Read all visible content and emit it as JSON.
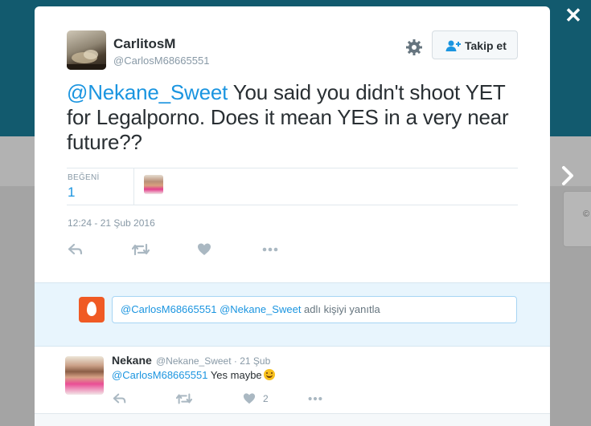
{
  "tweet": {
    "author": {
      "name": "CarlitosM",
      "handle": "@CarlosM68665551"
    },
    "follow_label": "Takip et",
    "text_mention": "@Nekane_Sweet",
    "text_rest": " You said you didn't shoot YET for Legalporno. Does it mean YES in a very near future??",
    "likes_label": "BEĞENİ",
    "likes_count": "1",
    "timestamp": "12:24 - 21 Şub 2016"
  },
  "reply_box": {
    "mention1": "@CarlosM68665551",
    "mention2": "@Nekane_Sweet",
    "suffix": " adlı kişiyi yanıtla"
  },
  "reply": {
    "name": "Nekane",
    "meta": "@Nekane_Sweet · 21 Şub",
    "mention": "@CarlosM68665551",
    "text": " Yes maybe",
    "like_count": "2"
  },
  "icons": [
    "close-icon",
    "chevron-right-icon",
    "gear-icon",
    "follow-user-icon",
    "reply-icon",
    "retweet-icon",
    "heart-icon",
    "more-icon",
    "egg-icon",
    "smiley-emoji-icon"
  ],
  "colors": {
    "accent": "#1b95e0",
    "header_bg": "#125a6e",
    "reply_bg": "#e8f5fd"
  }
}
